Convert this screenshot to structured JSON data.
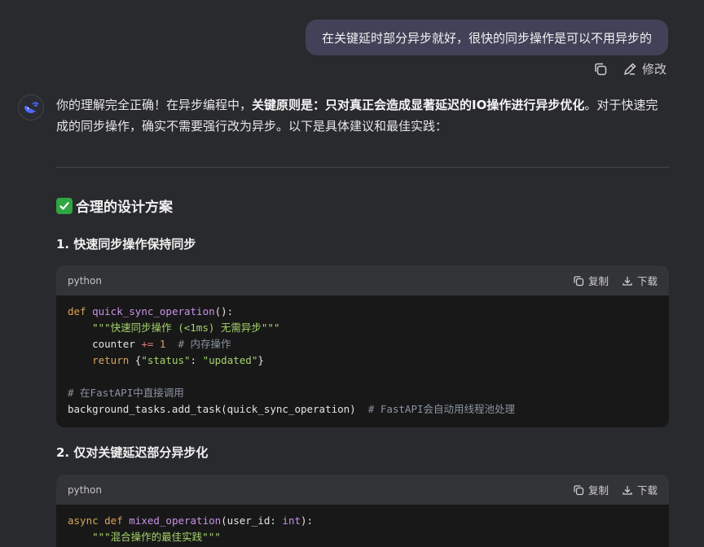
{
  "user_message": {
    "text": "在关键延时部分异步就好，很快的同步操作是可以不用异步的"
  },
  "message_actions": {
    "copy_label": "",
    "edit_label": "修改"
  },
  "reply": {
    "intro": {
      "part1": "你的理解完全正确！在异步编程中，",
      "bold1": "关键原则是：只对真正会造成显著延迟的IO操作进行异步优化",
      "part2": "。对于快速完成的同步操作，确实不需要强行改为异步。以下是具体建议和最佳实践："
    },
    "section_title": "合理的设计方案",
    "subsection1": "1. 快速同步操作保持同步",
    "subsection2": "2. 仅对关键延迟部分异步化",
    "code_blocks": [
      {
        "language": "python",
        "copy_label": "复制",
        "download_label": "下载",
        "lines": {
          "l1_kw": "def",
          "l1_fn": "quick_sync_operation",
          "l1_rest": "():",
          "l2_str": "\"\"\"快速同步操作 (<1ms) 无需异步\"\"\"",
          "l3_a": "counter ",
          "l3_op": "+=",
          "l3_num": " 1",
          "l3_cm": "  # 内存操作",
          "l4_kw": "return",
          "l4_a": " {",
          "l4_s1": "\"status\"",
          "l4_b": ": ",
          "l4_s2": "\"updated\"",
          "l4_c": "}",
          "l6_cm": "# 在FastAPI中直接调用",
          "l7_a": "background_tasks.add_task(quick_sync_operation)",
          "l7_cm": "  # FastAPI会自动用线程池处理"
        }
      },
      {
        "language": "python",
        "copy_label": "复制",
        "download_label": "下载",
        "lines": {
          "l1_kw": "async def",
          "l1_fn": "mixed_operation",
          "l1_a": "(user_id: ",
          "l1_bi": "int",
          "l1_b": "):",
          "l2_str": "\"\"\"混合操作的最佳实践\"\"\""
        }
      }
    ]
  },
  "colors": {
    "background": "#292a2d",
    "user_bubble": "#414158",
    "code_bg": "#181818",
    "code_header": "#333438",
    "check_green": "#2fa543"
  }
}
